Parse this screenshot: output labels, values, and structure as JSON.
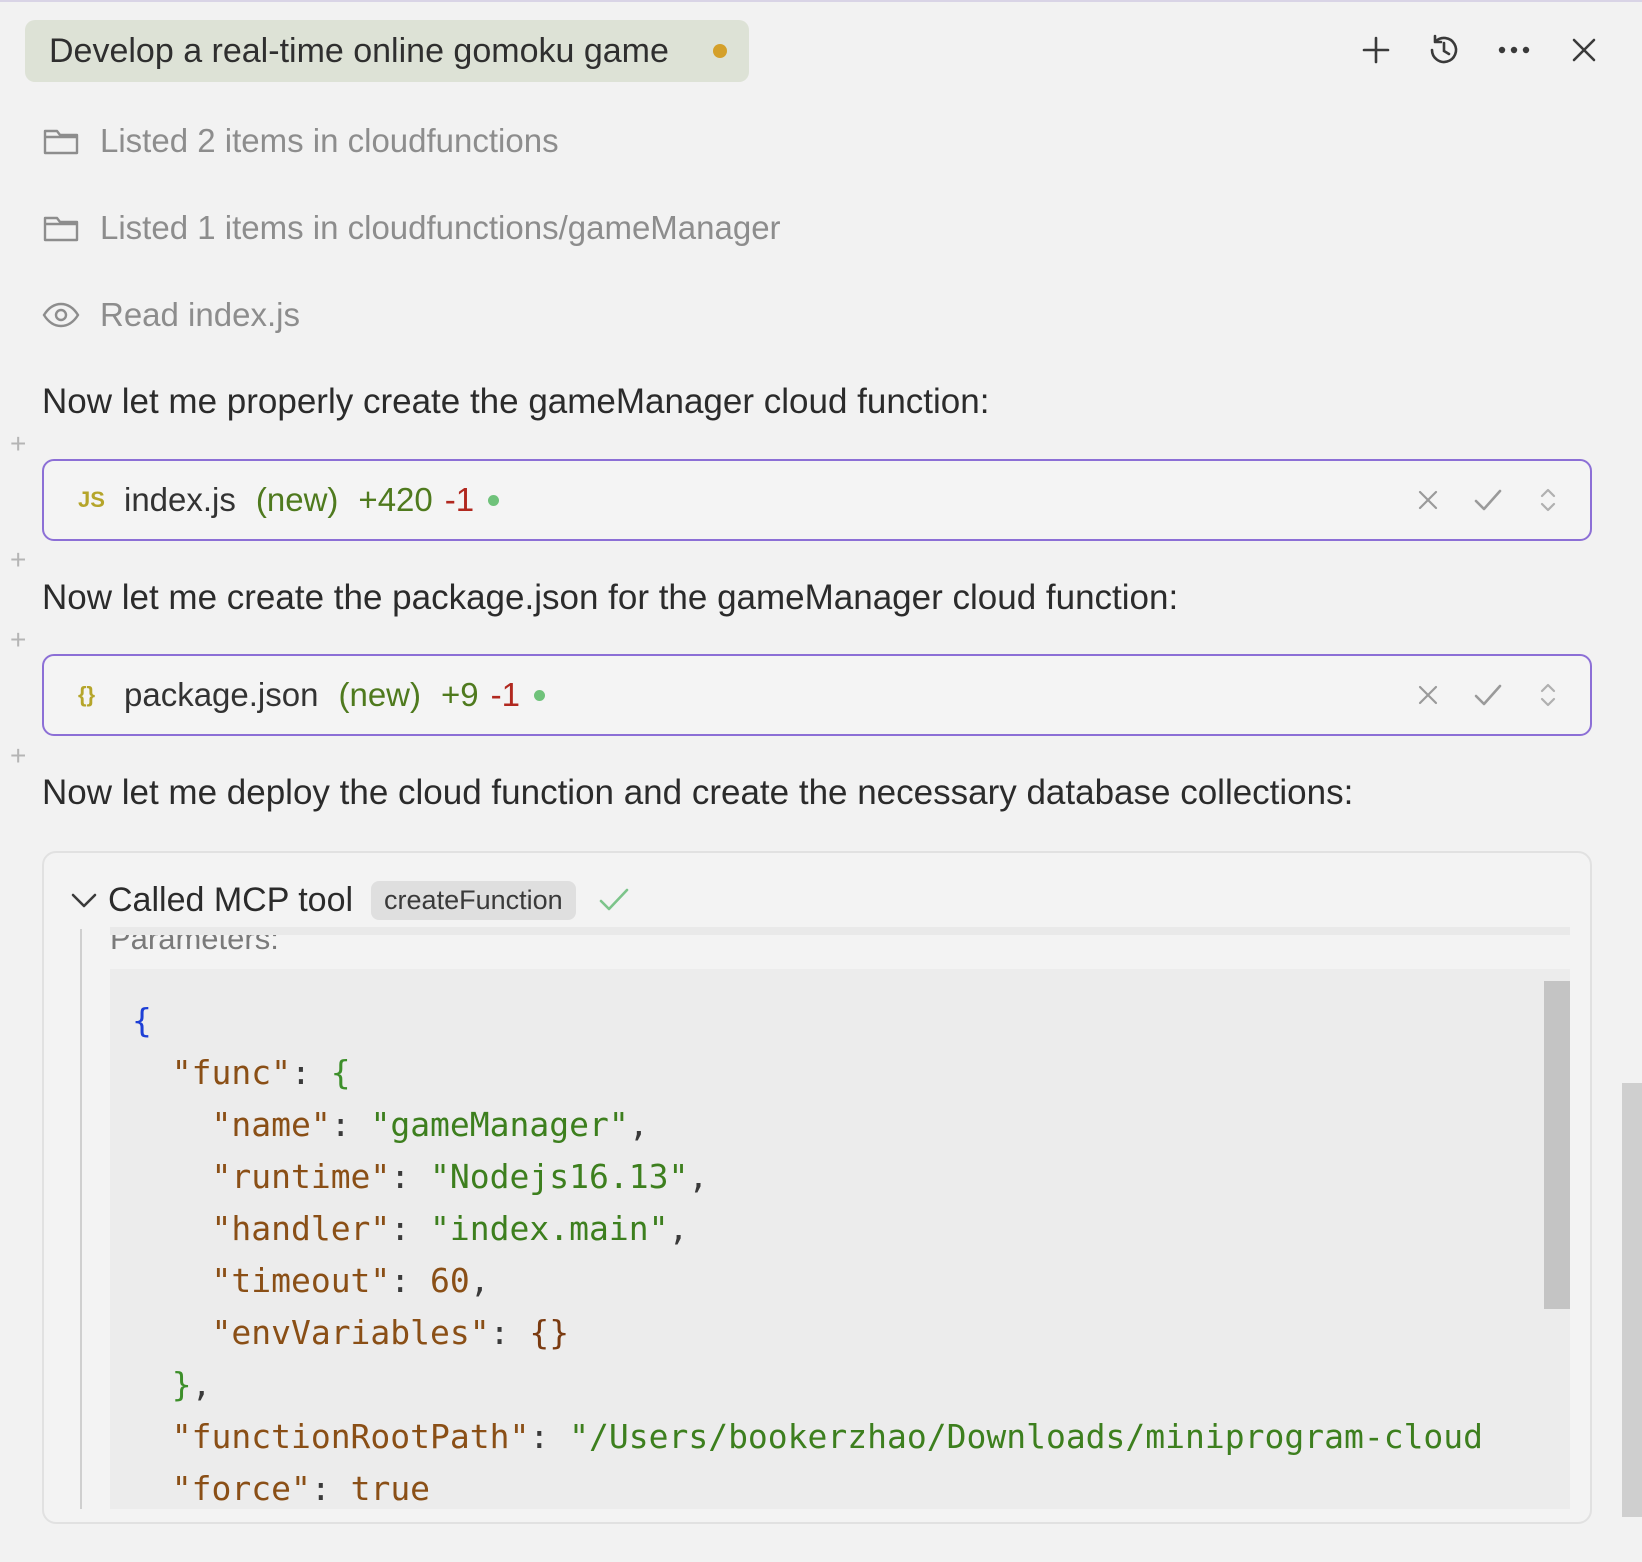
{
  "header": {
    "title": "Develop a real-time online gomoku game",
    "actions": [
      {
        "name": "new-chat",
        "icon": "plus-icon"
      },
      {
        "name": "history",
        "icon": "history-icon"
      },
      {
        "name": "more",
        "icon": "more-horizontal-icon"
      },
      {
        "name": "close",
        "icon": "close-icon"
      }
    ]
  },
  "activity": [
    {
      "icon": "folder-icon",
      "text": "Listed 2 items in cloudfunctions"
    },
    {
      "icon": "folder-icon",
      "text": "Listed 1 items in cloudfunctions/gameManager"
    },
    {
      "icon": "eye-icon",
      "text": "Read index.js"
    }
  ],
  "messages": {
    "m1": "Now let me properly create the gameManager cloud function:",
    "m2": "Now let me create the package.json for the gameManager cloud function:",
    "m3": "Now let me deploy the cloud function and create the necessary database collections:"
  },
  "files": [
    {
      "type_badge": "JS",
      "name": "index.js",
      "status": "(new)",
      "added": "+420",
      "removed": "-1"
    },
    {
      "type_badge": "{}",
      "name": "package.json",
      "status": "(new)",
      "added": "+9",
      "removed": "-1"
    }
  ],
  "tool_call": {
    "label": "Called MCP tool",
    "tool_name": "createFunction",
    "params_label": "Parameters:",
    "code": {
      "open": "{",
      "func_key": "\"func\"",
      "func_open": "{",
      "name_key": "\"name\"",
      "name_val": "\"gameManager\"",
      "runtime_key": "\"runtime\"",
      "runtime_val": "\"Nodejs16.13\"",
      "handler_key": "\"handler\"",
      "handler_val": "\"index.main\"",
      "timeout_key": "\"timeout\"",
      "timeout_val": "60",
      "env_key": "\"envVariables\"",
      "env_val": "{}",
      "func_close": "}",
      "root_key": "\"functionRootPath\"",
      "root_val": "\"/Users/bookerzhao/Downloads/miniprogram-cloud",
      "force_key": "\"force\"",
      "force_val": "true"
    }
  },
  "colors": {
    "accent_border": "#8c6fd6",
    "added": "#4f7a1e",
    "removed": "#b1281f",
    "title_chip": "#dde2d6"
  }
}
